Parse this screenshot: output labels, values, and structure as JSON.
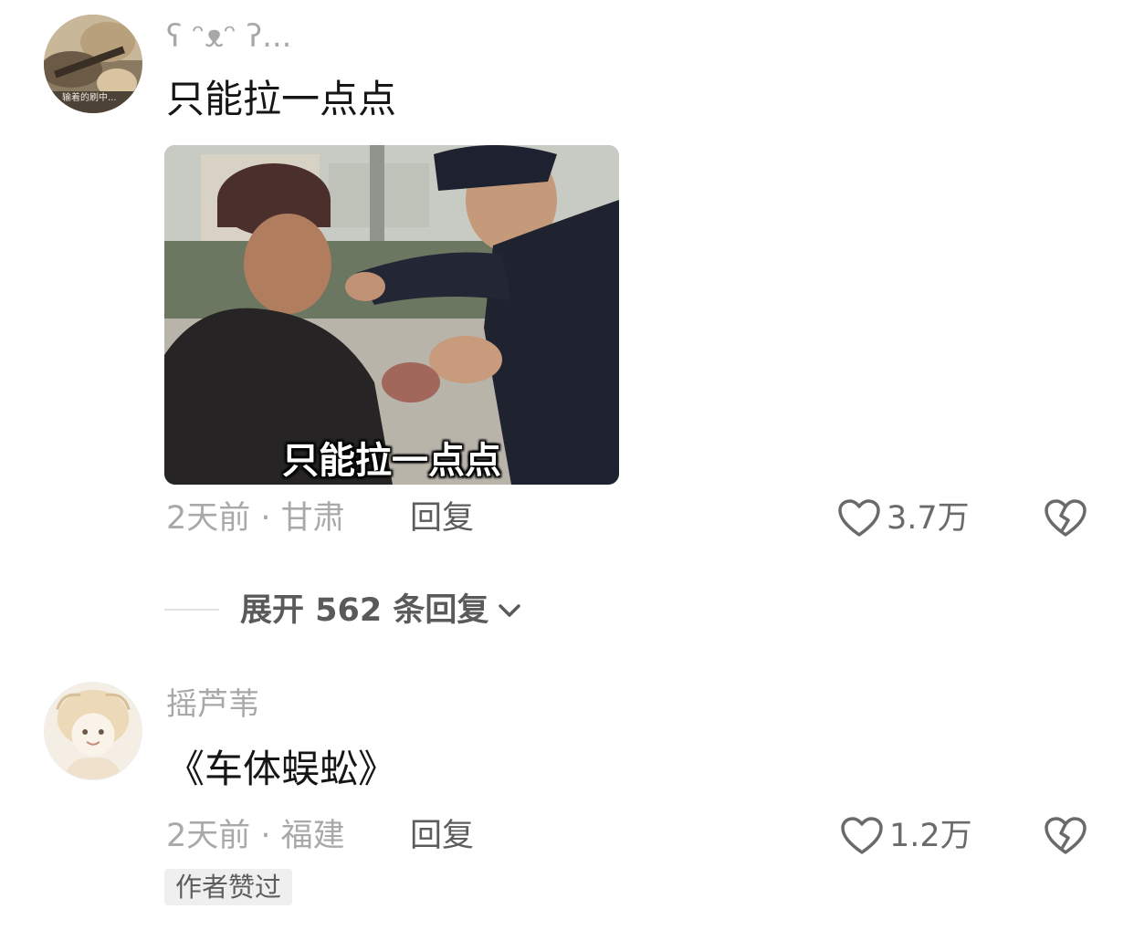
{
  "comments": [
    {
      "username": "ʕ ᵔᴥᵔ ʔ...",
      "text": "只能拉一点点",
      "image_caption": "只能拉一点点",
      "meta": "2天前 · 甘肃",
      "reply_label": "回复",
      "like_count": "3.7万",
      "avatar_text": "输着的刷中..."
    },
    {
      "username": "摇芦苇",
      "text": "《车体蜈蚣》",
      "meta": "2天前 · 福建",
      "reply_label": "回复",
      "like_count": "1.2万",
      "badge": "作者赞过"
    }
  ],
  "expand_replies_label": "展开 562 条回复",
  "icons": {
    "like": "heart-outline-icon",
    "dislike": "broken-heart-icon",
    "expand": "chevron-down-icon"
  },
  "colors": {
    "text_primary": "#161616",
    "text_secondary": "#a9a9a9",
    "badge_bg": "#efefef"
  }
}
